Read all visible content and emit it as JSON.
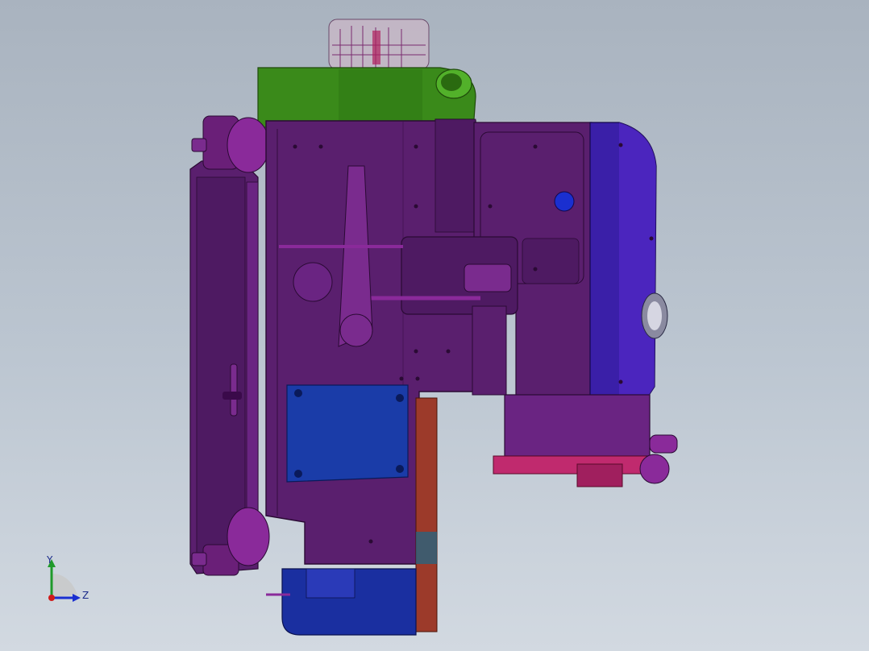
{
  "viewport": {
    "background_top": "#a9b3bf",
    "background_bottom": "#d2d9e1"
  },
  "model": {
    "colors": {
      "body_purple": "#5a1f6e",
      "body_purple_light": "#7a2b8e",
      "accent_magenta": "#8a1f86",
      "top_block_green": "#3a8a1a",
      "top_block_green_light": "#52b12a",
      "end_cover_blue": "#3a1fa8",
      "plate_blue": "#1a3ca8",
      "bottom_housing_blue": "#1a2fa0",
      "rust": "#9c3a2a",
      "pink_rail": "#c02a6e",
      "glass_top": "#d6b8c8"
    }
  },
  "triad": {
    "icon": "coordinate-triad-icon",
    "y_label": "Y",
    "z_label": "Z",
    "colors": {
      "y": "#1f9a2a",
      "z": "#1a2fd0",
      "x": "#d01a1a"
    }
  }
}
